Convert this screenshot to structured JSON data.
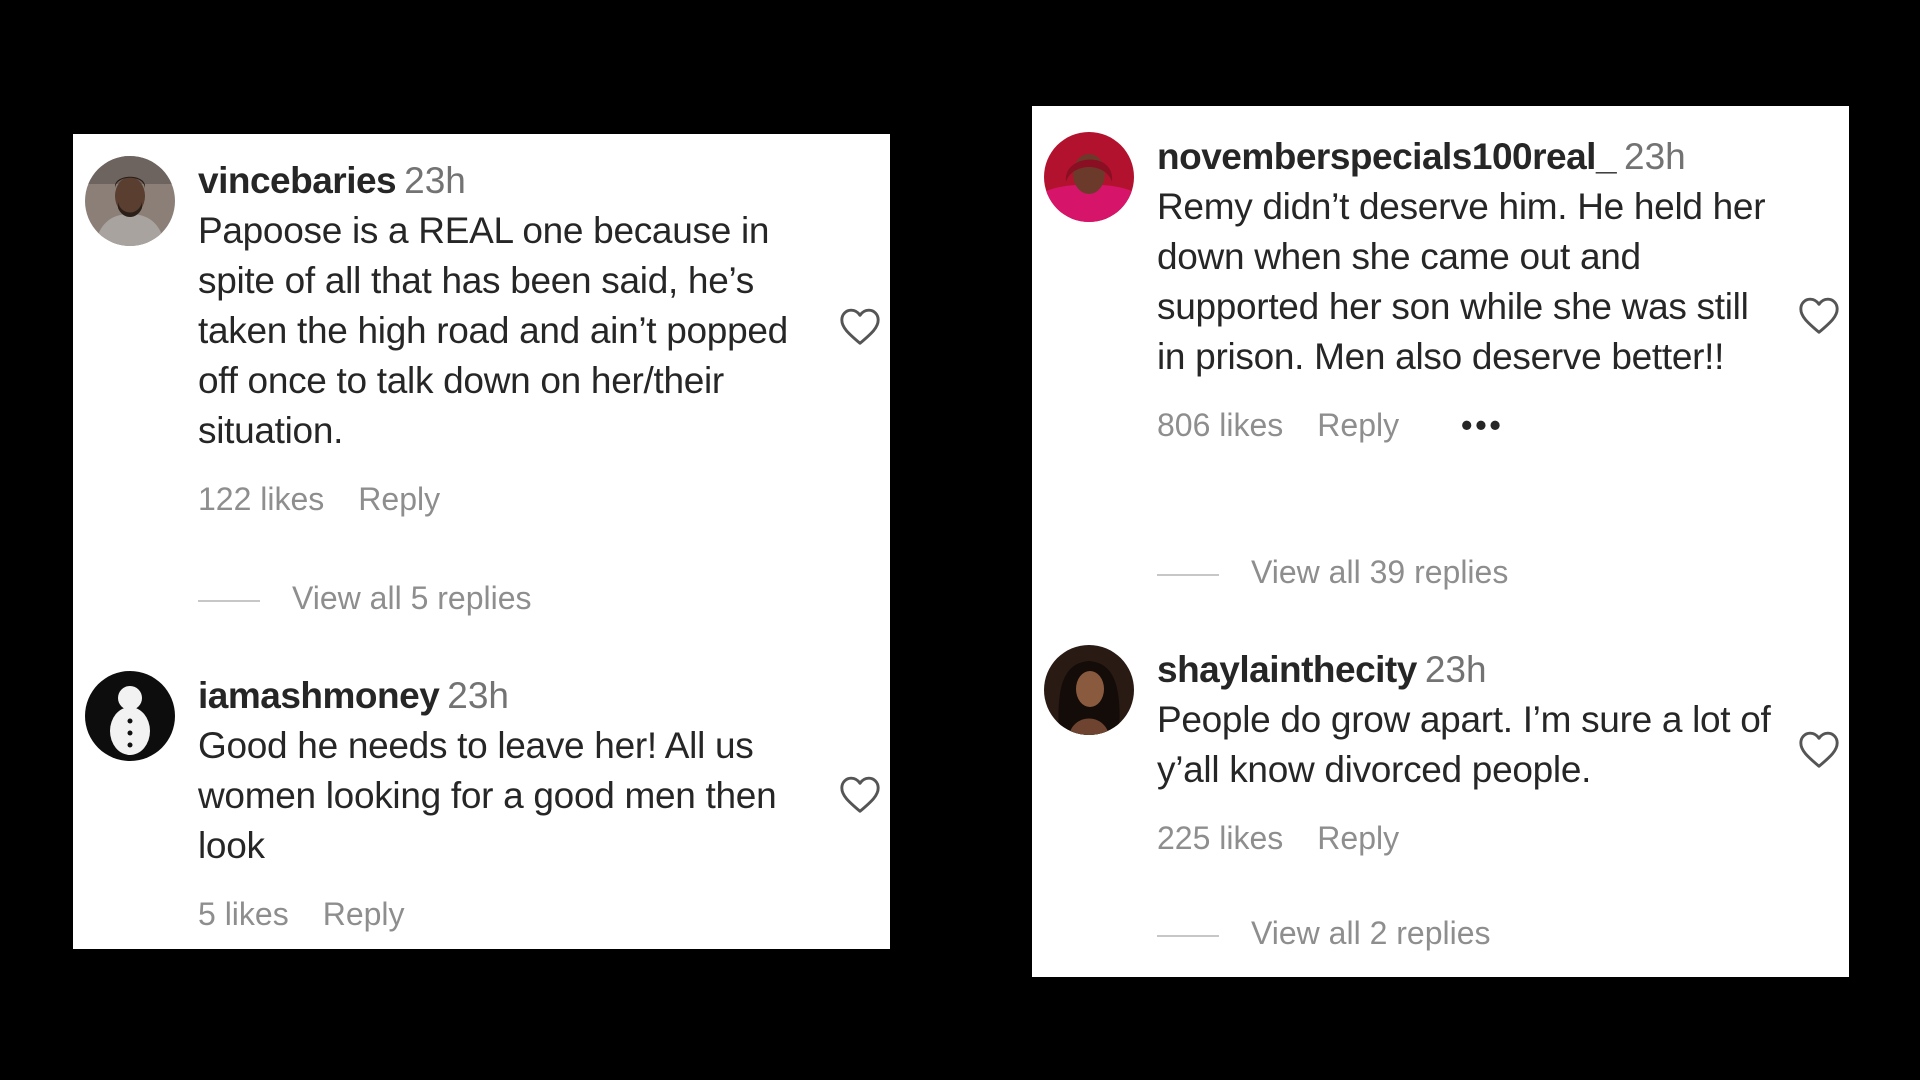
{
  "panels": {
    "left": {
      "comments": [
        {
          "username": "vincebaries",
          "time": "23h",
          "text": "Papoose is a REAL one because in spite of all that has been said, he’s taken the high road and ain’t popped off once to talk down on her/their situation.",
          "likes": "122 likes",
          "reply_label": "Reply",
          "view_replies": "View all 5 replies"
        },
        {
          "username": "iamashmoney",
          "time": "23h",
          "text": "Good he needs to leave her! All us women looking for a good men then look",
          "likes": "5 likes",
          "reply_label": "Reply"
        }
      ]
    },
    "right": {
      "comments": [
        {
          "username": "novemberspecials100real_",
          "time": "23h",
          "text": "Remy didn’t deserve him. He held her down when she came out and supported her son while she was still in prison. Men also deserve better!!",
          "likes": "806 likes",
          "reply_label": "Reply",
          "more_label": "•••",
          "view_replies": "View all 39 replies"
        },
        {
          "username": "shaylainthecity",
          "time": "23h",
          "text": "People do grow apart. I’m sure a lot of y’all know divorced people.",
          "likes": "225 likes",
          "reply_label": "Reply",
          "view_replies": "View all 2 replies"
        }
      ]
    }
  },
  "icons": {
    "like": "heart-outline-icon",
    "more": "more-options-icon"
  },
  "colors": {
    "background": "#000000",
    "panel": "#ffffff",
    "text": "#262626",
    "muted": "#8e8e8e"
  }
}
